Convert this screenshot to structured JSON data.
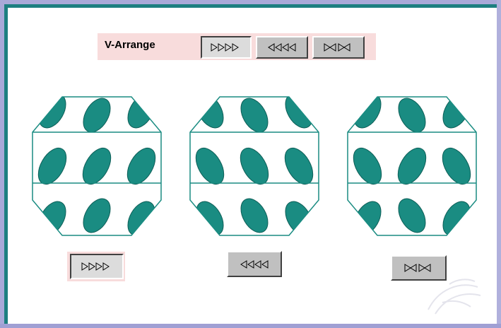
{
  "toolbar": {
    "label": "V-Arrange",
    "buttons": [
      {
        "icon": "triangles-right-icon",
        "selected": true
      },
      {
        "icon": "triangles-left-icon",
        "selected": false
      },
      {
        "icon": "triangles-bowtie-icon",
        "selected": false
      }
    ]
  },
  "previews": [
    {
      "name": "arrangement-right",
      "button_icon": "triangles-right-icon",
      "selected": true
    },
    {
      "name": "arrangement-left",
      "button_icon": "triangles-left-icon",
      "selected": false
    },
    {
      "name": "arrangement-bowtie",
      "button_icon": "triangles-bowtie-icon",
      "selected": false
    }
  ],
  "colors": {
    "accent": "#1a8c82",
    "border": "#1d7f80",
    "highlight": "#f8dcdc",
    "button_face": "#c0c0c0"
  }
}
